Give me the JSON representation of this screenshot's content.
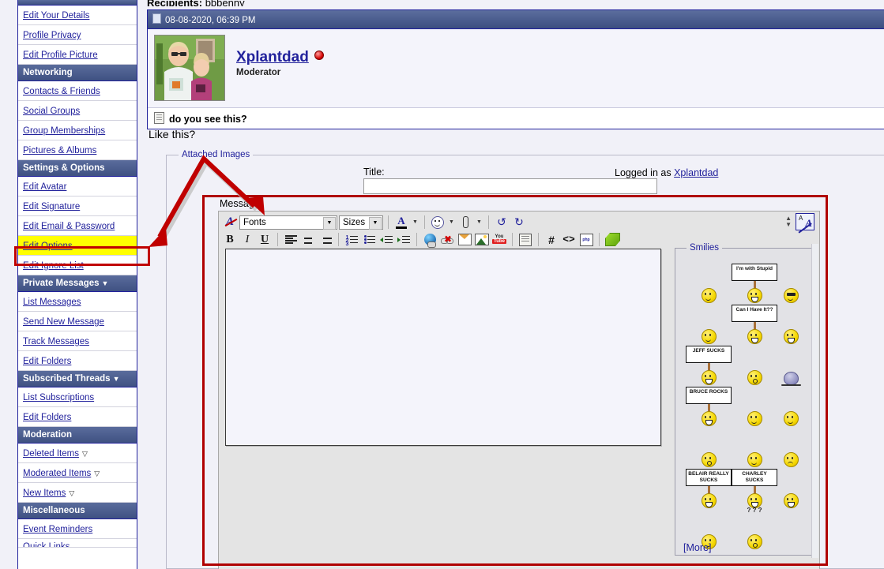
{
  "sidebar": {
    "sections": [
      {
        "header": "",
        "header_clipped": true,
        "items": [
          {
            "label": "Edit Your Details",
            "icon": null
          },
          {
            "label": "Profile Privacy",
            "icon": null
          },
          {
            "label": "Edit Profile Picture",
            "icon": null
          }
        ]
      },
      {
        "header": "Networking",
        "items": [
          {
            "label": "Contacts & Friends",
            "icon": null
          },
          {
            "label": "Social Groups",
            "icon": null
          },
          {
            "label": "Group Memberships",
            "icon": null
          },
          {
            "label": "Pictures & Albums",
            "icon": null
          }
        ]
      },
      {
        "header": "Settings & Options",
        "items": [
          {
            "label": "Edit Avatar",
            "icon": null
          },
          {
            "label": "Edit Signature",
            "icon": null
          },
          {
            "label": "Edit Email & Password",
            "icon": null
          },
          {
            "label": "Edit Options",
            "icon": null,
            "highlighted": true
          },
          {
            "label": "Edit Ignore List",
            "icon": null
          }
        ]
      },
      {
        "header": "Private Messages",
        "header_caret": "▼",
        "items": [
          {
            "label": "List Messages",
            "icon": null
          },
          {
            "label": "Send New Message",
            "icon": null
          },
          {
            "label": "Track Messages",
            "icon": null
          },
          {
            "label": "Edit Folders",
            "icon": null
          }
        ]
      },
      {
        "header": "Subscribed Threads",
        "header_caret": "▼",
        "items": [
          {
            "label": "List Subscriptions",
            "icon": null
          },
          {
            "label": "Edit Folders",
            "icon": null
          }
        ]
      },
      {
        "header": "Moderation",
        "items": [
          {
            "label": "Deleted Items",
            "icon": "chevron-down-outline-icon"
          },
          {
            "label": "Moderated Items",
            "icon": "chevron-down-outline-icon"
          },
          {
            "label": "New Items",
            "icon": "chevron-down-outline-icon"
          }
        ]
      },
      {
        "header": "Miscellaneous",
        "items": [
          {
            "label": "Event Reminders",
            "icon": null
          },
          {
            "label": "Quick Links",
            "icon": null,
            "clipped": true
          }
        ]
      }
    ]
  },
  "message_view": {
    "recipients_label": "Recipients",
    "recipients_value": "bbbenny",
    "post_date": "08-08-2020, 06:39 PM",
    "author": "Xplantdad",
    "author_role": "Moderator",
    "subject": "do you see this?"
  },
  "reply_form": {
    "like_this": "Like this?",
    "attached_images_legend": "Attached Images",
    "title_label": "Title:",
    "title_value": "",
    "logged_in_prefix": "Logged in as",
    "logged_in_user": "Xplantdad",
    "message_label": "Message:",
    "message_value": ""
  },
  "editor": {
    "fonts_select": "Fonts",
    "sizes_select": "Sizes",
    "row1": [
      {
        "name": "remove-formatting-icon",
        "label": "A"
      },
      {
        "name": "font-color-icon",
        "label": "A"
      },
      {
        "name": "smilie-dropdown-icon",
        "label": ""
      },
      {
        "name": "attachment-dropdown-icon",
        "label": ""
      },
      {
        "name": "undo-icon",
        "label": "↺"
      },
      {
        "name": "redo-icon",
        "label": "↻"
      }
    ],
    "row2": [
      {
        "name": "bold-button",
        "label": "B"
      },
      {
        "name": "italic-button",
        "label": "I"
      },
      {
        "name": "underline-button",
        "label": "U"
      },
      {
        "name": "align-left-button",
        "label": ""
      },
      {
        "name": "align-center-button",
        "label": ""
      },
      {
        "name": "align-right-button",
        "label": ""
      },
      {
        "name": "ordered-list-button",
        "label": ""
      },
      {
        "name": "unordered-list-button",
        "label": ""
      },
      {
        "name": "outdent-button",
        "label": ""
      },
      {
        "name": "indent-button",
        "label": ""
      },
      {
        "name": "insert-link-button",
        "label": ""
      },
      {
        "name": "remove-link-button",
        "label": ""
      },
      {
        "name": "insert-email-button",
        "label": ""
      },
      {
        "name": "insert-image-button",
        "label": ""
      },
      {
        "name": "insert-video-button",
        "label": "YouTube"
      },
      {
        "name": "insert-quote-button",
        "label": ""
      },
      {
        "name": "insert-hash-button",
        "label": "#"
      },
      {
        "name": "insert-code-button",
        "label": "<>"
      },
      {
        "name": "insert-php-button",
        "label": "php"
      },
      {
        "name": "insert-wrap-button",
        "label": ""
      }
    ],
    "toggle_mode_label": "A",
    "resize_up": "▲",
    "resize_down": "▼"
  },
  "smilies": {
    "legend": "Smilies",
    "more_label": "[More]",
    "grid": [
      [
        {
          "type": "face",
          "variant": "neutral",
          "name": "smilie-confused"
        },
        {
          "type": "sign",
          "text": "I'm with Stupid",
          "name": "smilie-im-with-stupid"
        },
        {
          "type": "face",
          "variant": "cool",
          "name": "smilie-cool"
        }
      ],
      [
        {
          "type": "face",
          "variant": "facepalm",
          "name": "smilie-facepalm"
        },
        {
          "type": "sign",
          "text": "Can I Have It??",
          "name": "smilie-can-i-have-it"
        },
        {
          "type": "face",
          "variant": "grin",
          "name": "smilie-big-grin"
        }
      ],
      [
        {
          "type": "sign",
          "text": "JEFF SUCKS",
          "name": "smilie-jeff-sucks"
        },
        {
          "type": "face",
          "variant": "o",
          "name": "smilie-surprised"
        },
        {
          "type": "blob",
          "name": "smilie-blob"
        }
      ],
      [
        {
          "type": "sign",
          "text": "BRUCE ROCKS",
          "name": "smilie-bruce-rocks"
        },
        {
          "type": "face",
          "variant": "peace",
          "name": "smilie-peace"
        },
        {
          "type": "face",
          "variant": "wave",
          "name": "smilie-wave"
        }
      ],
      [
        {
          "type": "face",
          "variant": "o",
          "name": "smilie-oh"
        },
        {
          "type": "face",
          "variant": "drink",
          "name": "smilie-drink"
        },
        {
          "type": "face",
          "variant": "sad",
          "name": "smilie-eek"
        }
      ],
      [
        {
          "type": "sign",
          "text": "BELAIR REALLY SUCKS",
          "name": "smilie-belair-really-sucks"
        },
        {
          "type": "sign",
          "text": "CHARLEY SUCKS",
          "name": "smilie-charley-sucks"
        },
        {
          "type": "face",
          "variant": "grin",
          "name": "smilie-teeth"
        }
      ],
      [
        {
          "type": "face",
          "variant": "smirk",
          "name": "smilie-smirk"
        },
        {
          "type": "face",
          "variant": "question",
          "name": "smilie-question"
        },
        {
          "type": "empty",
          "name": "smilie-empty"
        }
      ]
    ]
  },
  "annotations": {
    "accent_red": "#b00000",
    "highlight_yellow": "#ffff00"
  }
}
